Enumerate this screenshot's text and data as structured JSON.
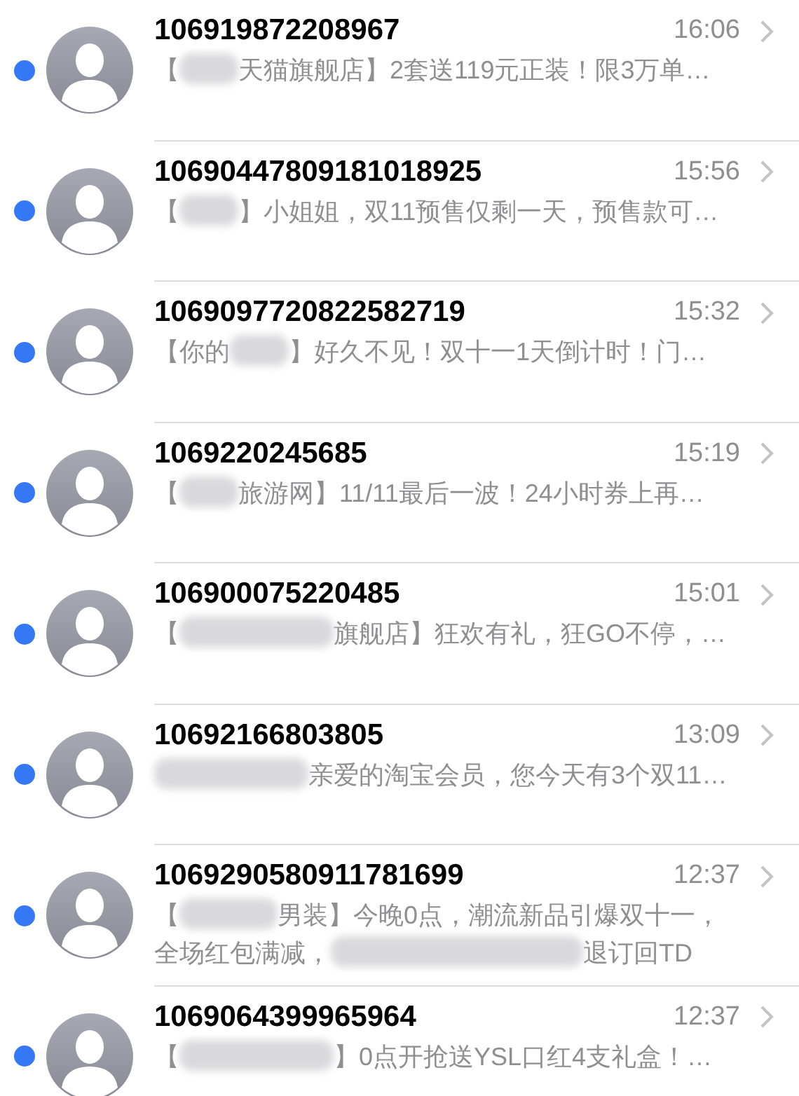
{
  "messages": [
    {
      "sender": "106919872208967",
      "time": "16:06",
      "unread": true,
      "preview": [
        {
          "kind": "text",
          "text": "【"
        },
        {
          "kind": "blur-short"
        },
        {
          "kind": "text",
          "text": "天猫旗舰店】2套送119元正装！限3万单…"
        }
      ]
    },
    {
      "sender": "10690447809181018925",
      "time": "15:56",
      "unread": true,
      "preview": [
        {
          "kind": "text",
          "text": "【"
        },
        {
          "kind": "blur-short"
        },
        {
          "kind": "text",
          "text": "】小姐姐，双11预售仅剩一天，预售款可…"
        }
      ]
    },
    {
      "sender": "1069097720822582719",
      "time": "15:32",
      "unread": true,
      "preview": [
        {
          "kind": "text",
          "text": "【你的"
        },
        {
          "kind": "blur-short"
        },
        {
          "kind": "text",
          "text": "】好久不见！双十一1天倒计时！门…"
        }
      ]
    },
    {
      "sender": "1069220245685",
      "time": "15:19",
      "unread": true,
      "preview": [
        {
          "kind": "text",
          "text": "【"
        },
        {
          "kind": "blur-short"
        },
        {
          "kind": "text",
          "text": "旅游网】11/11最后一波！24小时券上再…"
        }
      ]
    },
    {
      "sender": "106900075220485",
      "time": "15:01",
      "unread": true,
      "preview": [
        {
          "kind": "text",
          "text": "【"
        },
        {
          "kind": "blur-long"
        },
        {
          "kind": "text",
          "text": "旗舰店】狂欢有礼，狂GO不停，…"
        }
      ]
    },
    {
      "sender": "10692166803805",
      "time": "13:09",
      "unread": true,
      "preview": [
        {
          "kind": "blur-long"
        },
        {
          "kind": "text",
          "text": "亲爱的淘宝会员，您今天有3个双11…"
        }
      ]
    },
    {
      "sender": "1069290580911781699",
      "time": "12:37",
      "unread": true,
      "preview": [
        {
          "kind": "text",
          "text": "【"
        },
        {
          "kind": "blur-medium"
        },
        {
          "kind": "text",
          "text": "男装】今晚0点，潮流新品引爆双十一，"
        },
        {
          "kind": "break"
        },
        {
          "kind": "text",
          "text": "全场红包满减，"
        },
        {
          "kind": "blur-wide"
        },
        {
          "kind": "text",
          "text": "退订回TD"
        }
      ]
    },
    {
      "sender": "1069064399965964",
      "time": "12:37",
      "unread": true,
      "preview": [
        {
          "kind": "text",
          "text": "【"
        },
        {
          "kind": "blur-long"
        },
        {
          "kind": "text",
          "text": "】0点开抢送YSL口红4支礼盒！…"
        }
      ]
    }
  ]
}
